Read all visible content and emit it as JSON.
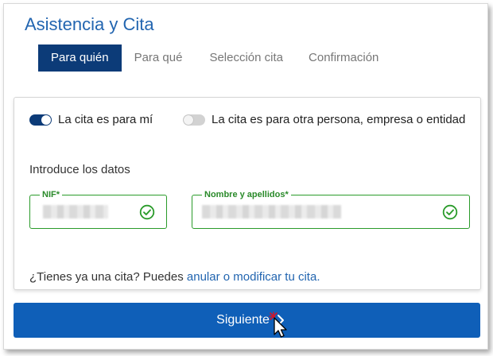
{
  "page": {
    "title": "Asistencia y Cita"
  },
  "tabs": [
    {
      "label": "Para quién",
      "active": true
    },
    {
      "label": "Para qué",
      "active": false
    },
    {
      "label": "Selección cita",
      "active": false
    },
    {
      "label": "Confirmación",
      "active": false
    }
  ],
  "options": {
    "self": {
      "label": "La cita es para mí",
      "checked": true
    },
    "other": {
      "label": "La cita es para otra persona, empresa o entidad",
      "checked": false
    }
  },
  "form": {
    "intro": "Introduce los datos",
    "nif": {
      "label": "NIF*",
      "value": ""
    },
    "name": {
      "label": "Nombre y apellidos*",
      "value": ""
    }
  },
  "existing": {
    "question": "¿Tienes ya una cita? Puedes ",
    "link": "anular o modificar tu cita."
  },
  "actions": {
    "next_label": "Siguiente"
  },
  "colors": {
    "brand_blue": "#2265b0",
    "active_tab": "#0c3b78",
    "button": "#0f5fb8",
    "valid_green": "#2a9b2a"
  },
  "icons": {
    "valid": "check-circle-icon",
    "next": "chevron-right-icon",
    "pointer": "mouse-cursor-icon"
  }
}
